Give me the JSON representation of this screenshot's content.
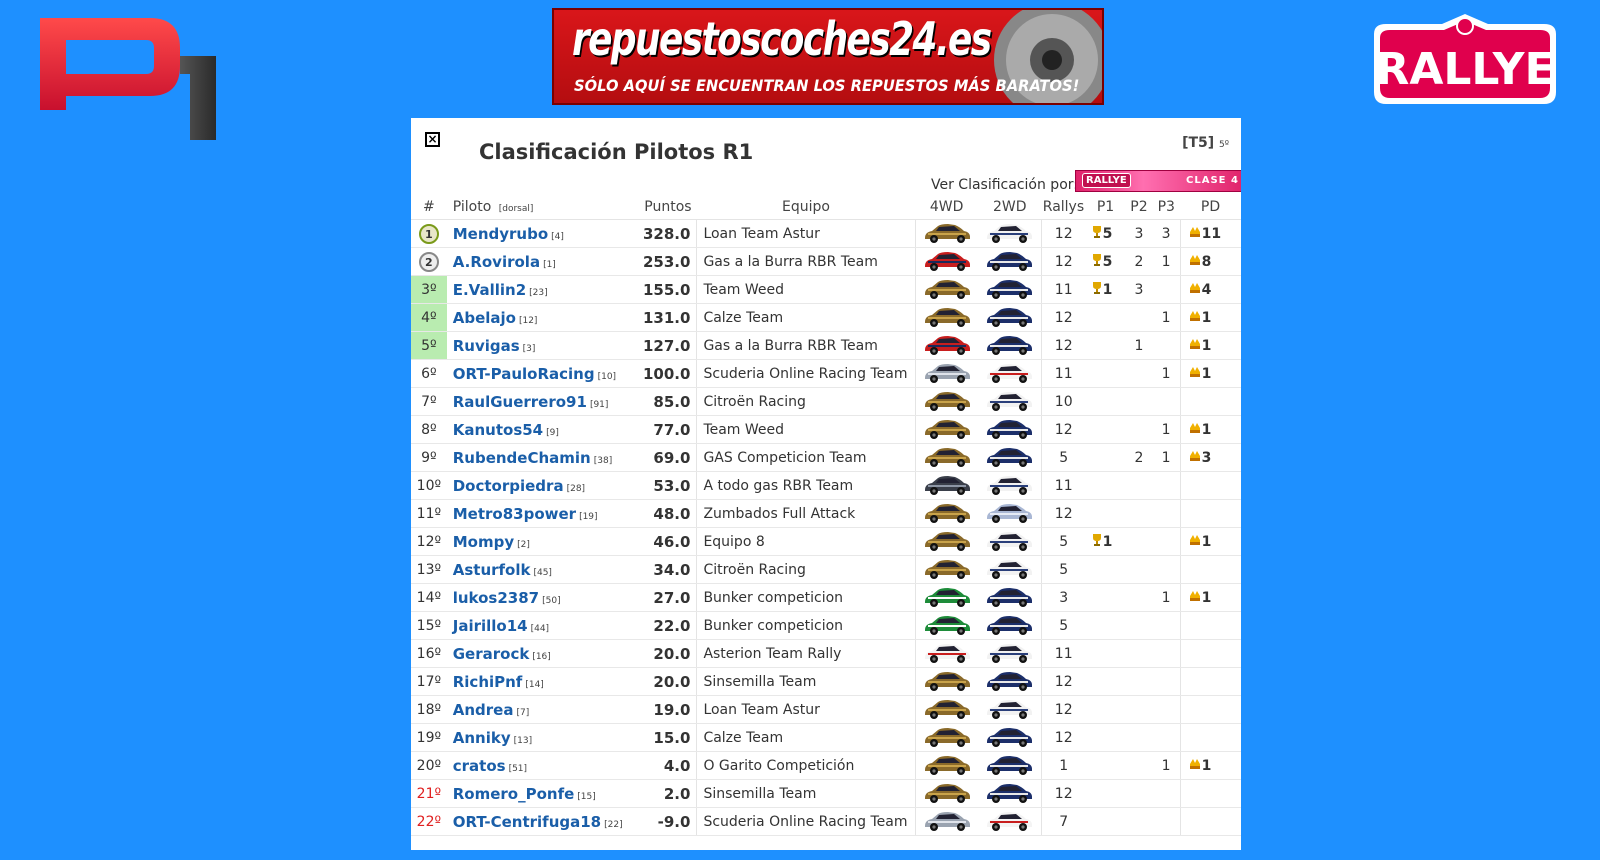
{
  "banner": {
    "title": "repuestoscoches24.es",
    "subtitle": "SÓLO AQUÍ SE ENCUENTRAN LOS REPUESTOS MÁS BARATOS!"
  },
  "rallye_badge": {
    "text": "RALLYE"
  },
  "panel": {
    "title": "Clasificación Pilotos R1",
    "temporada": "[T5]",
    "temporada_sub": "5º",
    "ver_label": "Ver Clasificación por:",
    "filter_left": "RALLYE",
    "filter_right": "CLASE 4"
  },
  "headers": {
    "pos": "#",
    "pilot": "Piloto",
    "pilot_sub": "[dorsal]",
    "points": "Puntos",
    "team": "Equipo",
    "c4wd": "4WD",
    "c2wd": "2WD",
    "rallys": "Rallys",
    "p1": "P1",
    "p2": "P2",
    "p3": "P3",
    "pd": "PD"
  },
  "colors": {
    "background": "#1e90ff",
    "name": "#1a5ea8",
    "highlight_green": "#b9ecb0",
    "relegation_red": "#e02020"
  },
  "rows": [
    {
      "pos": "1",
      "medal": "gold",
      "name": "Mendyrubo",
      "dorsal": "[4]",
      "pts": "328.0",
      "team": "Loan Team Astur",
      "car4": "gold",
      "car2": "white",
      "rallys": "12",
      "p1": "5",
      "p2": "3",
      "p3": "3",
      "pd": "11",
      "zone": "medal"
    },
    {
      "pos": "2",
      "medal": "silver",
      "name": "A.Rovirola",
      "dorsal": "[1]",
      "pts": "253.0",
      "team": "Gas a la Burra RBR Team",
      "car4": "red",
      "car2": "blue",
      "rallys": "12",
      "p1": "5",
      "p2": "2",
      "p3": "1",
      "pd": "8",
      "zone": "medal"
    },
    {
      "pos": "3º",
      "name": "E.Vallin2",
      "dorsal": "[23]",
      "pts": "155.0",
      "team": "Team Weed",
      "car4": "gold",
      "car2": "blue",
      "rallys": "11",
      "p1": "1",
      "p2": "3",
      "p3": "",
      "pd": "4",
      "zone": "green"
    },
    {
      "pos": "4º",
      "name": "Abelajo",
      "dorsal": "[12]",
      "pts": "131.0",
      "team": "Calze Team",
      "car4": "gold",
      "car2": "blue",
      "rallys": "12",
      "p1": "",
      "p2": "",
      "p3": "1",
      "pd": "1",
      "zone": "green"
    },
    {
      "pos": "5º",
      "name": "Ruvigas",
      "dorsal": "[3]",
      "pts": "127.0",
      "team": "Gas a la Burra RBR Team",
      "car4": "red",
      "car2": "blue",
      "rallys": "12",
      "p1": "",
      "p2": "1",
      "p3": "",
      "pd": "1",
      "zone": "green"
    },
    {
      "pos": "6º",
      "name": "ORT-PauloRacing",
      "dorsal": "[10]",
      "pts": "100.0",
      "team": "Scuderia Online Racing Team",
      "car4": "silver",
      "car2": "whitered",
      "rallys": "11",
      "p1": "",
      "p2": "",
      "p3": "1",
      "pd": "1",
      "zone": ""
    },
    {
      "pos": "7º",
      "name": "RaulGuerrero91",
      "dorsal": "[91]",
      "pts": "85.0",
      "team": "Citroën Racing",
      "car4": "gold",
      "car2": "white",
      "rallys": "10",
      "p1": "",
      "p2": "",
      "p3": "",
      "pd": "",
      "zone": ""
    },
    {
      "pos": "8º",
      "name": "Kanutos54",
      "dorsal": "[9]",
      "pts": "77.0",
      "team": "Team Weed",
      "car4": "gold",
      "car2": "blue",
      "rallys": "12",
      "p1": "",
      "p2": "",
      "p3": "1",
      "pd": "1",
      "zone": ""
    },
    {
      "pos": "9º",
      "name": "RubendeChamin",
      "dorsal": "[38]",
      "pts": "69.0",
      "team": "GAS Competicion Team",
      "car4": "gold",
      "car2": "blue",
      "rallys": "5",
      "p1": "",
      "p2": "2",
      "p3": "1",
      "pd": "3",
      "zone": ""
    },
    {
      "pos": "10º",
      "name": "Doctorpiedra",
      "dorsal": "[28]",
      "pts": "53.0",
      "team": "A todo gas RBR Team",
      "car4": "dark",
      "car2": "white",
      "rallys": "11",
      "p1": "",
      "p2": "",
      "p3": "",
      "pd": "",
      "zone": ""
    },
    {
      "pos": "11º",
      "name": "Metro83power",
      "dorsal": "[19]",
      "pts": "48.0",
      "team": "Zumbados Full Attack",
      "car4": "gold",
      "car2": "lightblue",
      "rallys": "12",
      "p1": "",
      "p2": "",
      "p3": "",
      "pd": "",
      "zone": ""
    },
    {
      "pos": "12º",
      "name": "Mompy",
      "dorsal": "[2]",
      "pts": "46.0",
      "team": "Equipo 8",
      "car4": "gold",
      "car2": "white",
      "rallys": "5",
      "p1": "1",
      "p2": "",
      "p3": "",
      "pd": "1",
      "zone": ""
    },
    {
      "pos": "13º",
      "name": "Asturfolk",
      "dorsal": "[45]",
      "pts": "34.0",
      "team": "Citroën Racing",
      "car4": "gold",
      "car2": "white",
      "rallys": "5",
      "p1": "",
      "p2": "",
      "p3": "",
      "pd": "",
      "zone": ""
    },
    {
      "pos": "14º",
      "name": "lukos2387",
      "dorsal": "[50]",
      "pts": "27.0",
      "team": "Bunker competicion",
      "car4": "green",
      "car2": "blue",
      "rallys": "3",
      "p1": "",
      "p2": "",
      "p3": "1",
      "pd": "1",
      "zone": ""
    },
    {
      "pos": "15º",
      "name": "Jairillo14",
      "dorsal": "[44]",
      "pts": "22.0",
      "team": "Bunker competicion",
      "car4": "green",
      "car2": "blue",
      "rallys": "5",
      "p1": "",
      "p2": "",
      "p3": "",
      "pd": "",
      "zone": ""
    },
    {
      "pos": "16º",
      "name": "Gerarock",
      "dorsal": "[16]",
      "pts": "20.0",
      "team": "Asterion Team Rally",
      "car4": "whitered",
      "car2": "white",
      "rallys": "11",
      "p1": "",
      "p2": "",
      "p3": "",
      "pd": "",
      "zone": ""
    },
    {
      "pos": "17º",
      "name": "RichiPnf",
      "dorsal": "[14]",
      "pts": "20.0",
      "team": "Sinsemilla Team",
      "car4": "gold",
      "car2": "blue",
      "rallys": "12",
      "p1": "",
      "p2": "",
      "p3": "",
      "pd": "",
      "zone": ""
    },
    {
      "pos": "18º",
      "name": "Andrea",
      "dorsal": "[7]",
      "pts": "19.0",
      "team": "Loan Team Astur",
      "car4": "gold",
      "car2": "white",
      "rallys": "12",
      "p1": "",
      "p2": "",
      "p3": "",
      "pd": "",
      "zone": ""
    },
    {
      "pos": "19º",
      "name": "Anniky",
      "dorsal": "[13]",
      "pts": "15.0",
      "team": "Calze Team",
      "car4": "gold",
      "car2": "blue",
      "rallys": "12",
      "p1": "",
      "p2": "",
      "p3": "",
      "pd": "",
      "zone": ""
    },
    {
      "pos": "20º",
      "name": "cratos",
      "dorsal": "[51]",
      "pts": "4.0",
      "team": "O Garito Competición",
      "car4": "gold",
      "car2": "blue",
      "rallys": "1",
      "p1": "",
      "p2": "",
      "p3": "1",
      "pd": "1",
      "zone": ""
    },
    {
      "pos": "21º",
      "name": "Romero_Ponfe",
      "dorsal": "[15]",
      "pts": "2.0",
      "team": "Sinsemilla Team",
      "car4": "gold",
      "car2": "blue",
      "rallys": "12",
      "p1": "",
      "p2": "",
      "p3": "",
      "pd": "",
      "zone": "red"
    },
    {
      "pos": "22º",
      "name": "ORT-Centrifuga18",
      "dorsal": "[22]",
      "pts": "-9.0",
      "team": "Scuderia Online Racing Team",
      "car4": "silver",
      "car2": "whitered",
      "rallys": "7",
      "p1": "",
      "p2": "",
      "p3": "",
      "pd": "",
      "zone": "red"
    }
  ]
}
